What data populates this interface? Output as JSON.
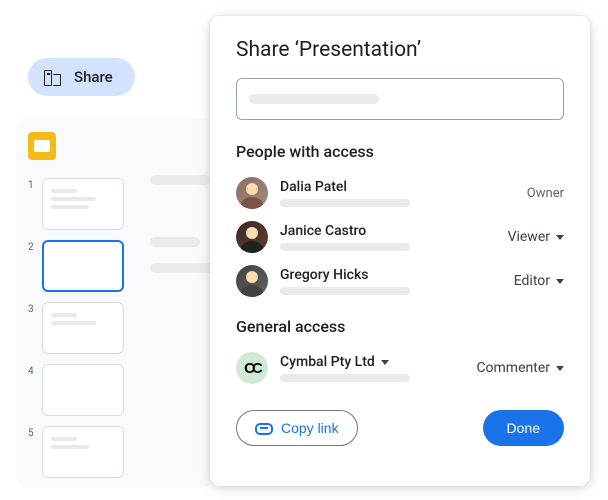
{
  "share_chip": {
    "label": "Share"
  },
  "modal": {
    "title": "Share ‘Presentation’",
    "people_section_title": "People with access",
    "people": [
      {
        "name": "Dalia Patel",
        "role": "Owner",
        "role_type": "static"
      },
      {
        "name": "Janice Castro",
        "role": "Viewer",
        "role_type": "dropdown"
      },
      {
        "name": "Gregory Hicks",
        "role": "Editor",
        "role_type": "dropdown"
      }
    ],
    "general_section_title": "General access",
    "general": {
      "org_name": "Cymbal Pty Ltd",
      "org_logo_text": "CC",
      "role": "Commenter"
    },
    "copy_link_label": "Copy link",
    "done_label": "Done"
  },
  "thumbs": [
    "1",
    "2",
    "3",
    "4",
    "5"
  ]
}
